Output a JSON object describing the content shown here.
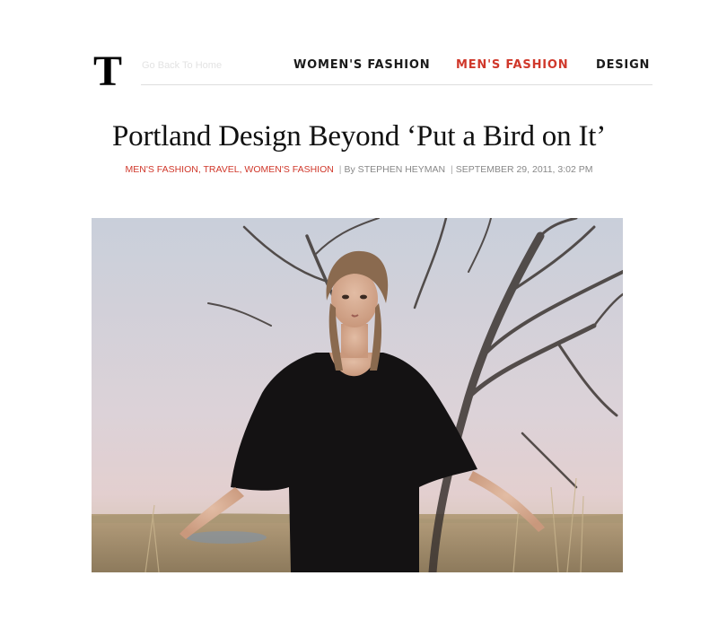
{
  "header": {
    "logo": {
      "icon": "nyt-t-logo-icon",
      "label": "T"
    },
    "back_link": "Go Back To Home",
    "nav": [
      {
        "label": "WOMEN'S FASHION",
        "active": false
      },
      {
        "label": "MEN'S FASHION",
        "active": true
      },
      {
        "label": "DESIGN",
        "active": false
      }
    ]
  },
  "article": {
    "title": "Portland Design Beyond ‘Put a Bird on It’",
    "categories": [
      {
        "label": "MEN'S FASHION"
      },
      {
        "label": "TRAVEL"
      },
      {
        "label": "WOMEN'S FASHION"
      }
    ],
    "byline": "By STEPHEN HEYMAN",
    "date": "SEPTEMBER 29, 2011, 3:02 PM"
  },
  "colors": {
    "accent": "#d0382b",
    "text": "#111111"
  }
}
